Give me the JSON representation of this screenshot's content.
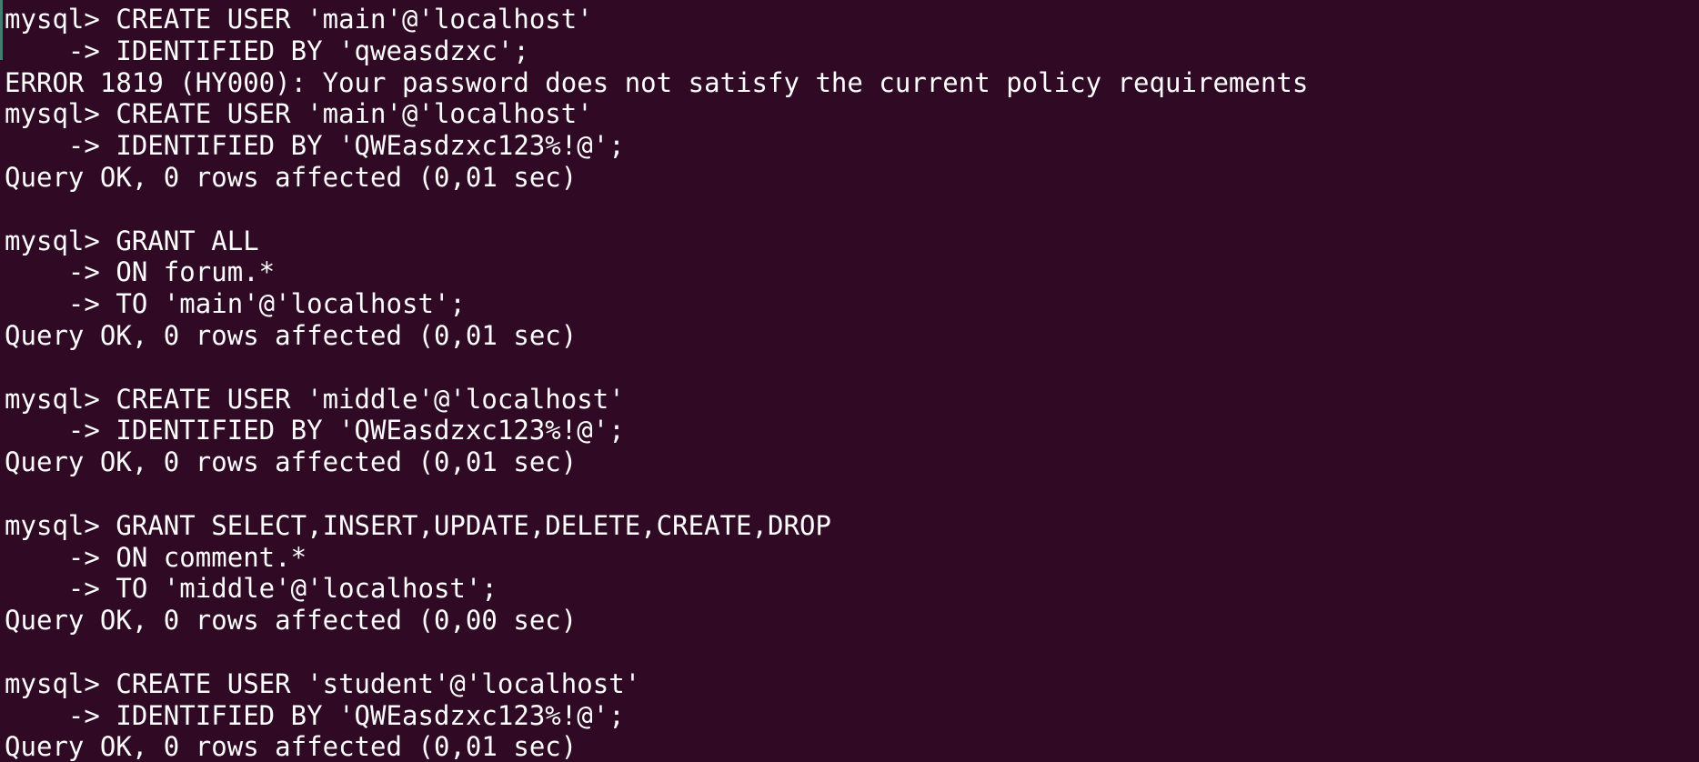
{
  "terminal": {
    "background": "#300a24",
    "foreground": "#ffffff",
    "lines": [
      "mysql> CREATE USER 'main'@'localhost'",
      "    -> IDENTIFIED BY 'qweasdzxc';",
      "ERROR 1819 (HY000): Your password does not satisfy the current policy requirements",
      "mysql> CREATE USER 'main'@'localhost'",
      "    -> IDENTIFIED BY 'QWEasdzxc123%!@';",
      "Query OK, 0 rows affected (0,01 sec)",
      "",
      "mysql> GRANT ALL",
      "    -> ON forum.*",
      "    -> TO 'main'@'localhost';",
      "Query OK, 0 rows affected (0,01 sec)",
      "",
      "mysql> CREATE USER 'middle'@'localhost'",
      "    -> IDENTIFIED BY 'QWEasdzxc123%!@';",
      "Query OK, 0 rows affected (0,01 sec)",
      "",
      "mysql> GRANT SELECT,INSERT,UPDATE,DELETE,CREATE,DROP",
      "    -> ON comment.*",
      "    -> TO 'middle'@'localhost';",
      "Query OK, 0 rows affected (0,00 sec)",
      "",
      "mysql> CREATE USER 'student'@'localhost'",
      "    -> IDENTIFIED BY 'QWEasdzxc123%!@';",
      "Query OK, 0 rows affected (0,01 sec)"
    ]
  }
}
